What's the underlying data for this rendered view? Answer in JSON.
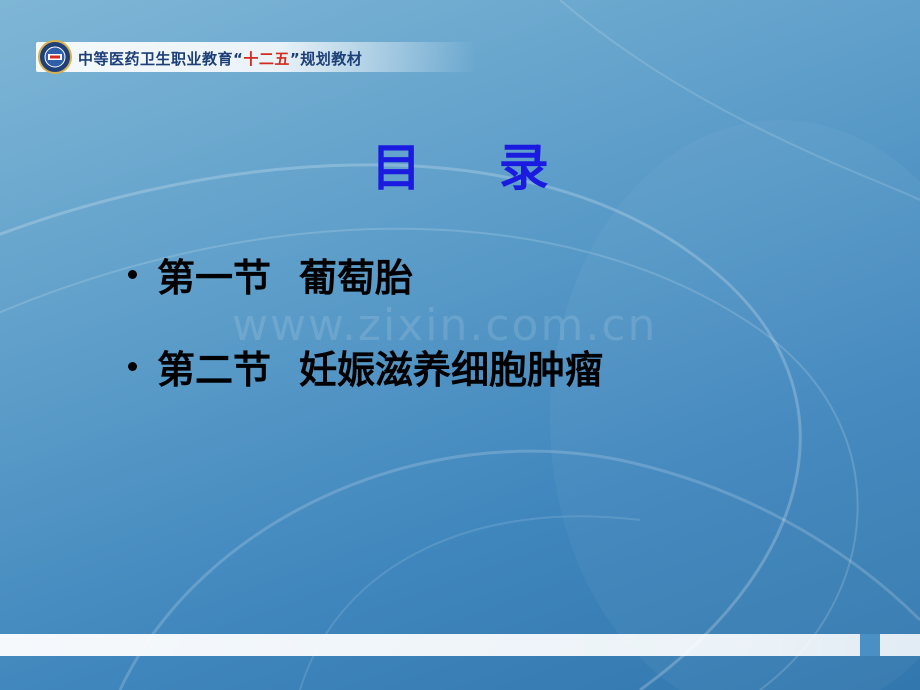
{
  "header": {
    "text_before": "中等医药卫生职业教育",
    "quote_open": "“",
    "highlight": "十二五",
    "quote_close": "”",
    "text_after": "规划教材"
  },
  "title": "目 录",
  "toc": [
    {
      "section": "第一节",
      "topic": "葡萄胎"
    },
    {
      "section": "第二节",
      "topic": "妊娠滋养细胞肿瘤"
    }
  ],
  "watermark": "www.zixin.com.cn",
  "colors": {
    "title": "#1a1ae0",
    "header_text": "#1c3f78",
    "header_highlight": "#d42a1f",
    "background": "#3f86bd"
  }
}
